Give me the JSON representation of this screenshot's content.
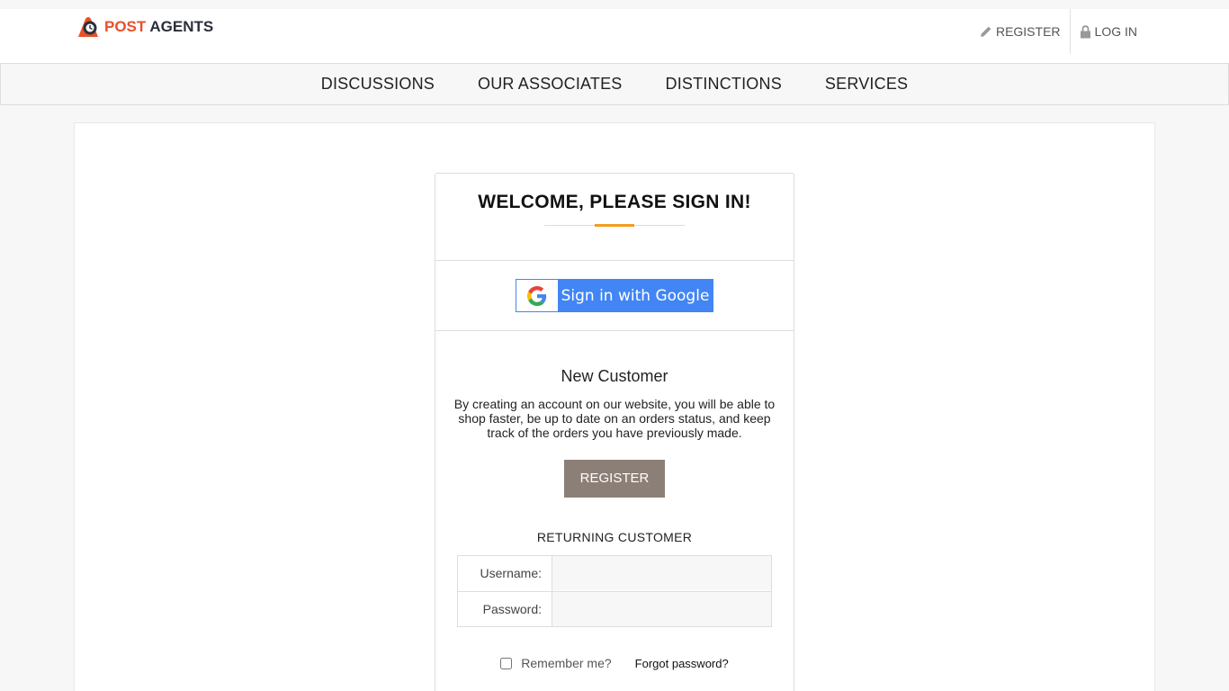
{
  "header": {
    "logo_part1": "POST",
    "logo_part2": "AGENTS",
    "register_label": "REGISTER",
    "login_label": "LOG IN"
  },
  "nav": {
    "items": [
      "DISCUSSIONS",
      "OUR ASSOCIATES",
      "DISTINCTIONS",
      "SERVICES"
    ]
  },
  "login_card": {
    "title": "WELCOME, PLEASE SIGN IN!",
    "google_label": "Sign in with Google",
    "new_customer_heading": "New Customer",
    "new_customer_text": "By creating an account on our website, you will be able to shop faster, be up to date on an orders status, and keep track of the orders you have previously made.",
    "register_button": "REGISTER",
    "returning_heading": "RETURNING CUSTOMER",
    "username_label": "Username:",
    "username_value": "",
    "password_label": "Password:",
    "password_value": "",
    "remember_label": "Remember me?",
    "remember_checked": false,
    "forgot_label": "Forgot password?"
  },
  "colors": {
    "brand_orange": "#e8502a",
    "accent_rule": "#f39c1f",
    "google_blue": "#4285f4",
    "register_button_bg": "#8c7f77"
  },
  "icons": {
    "register": "pencil-icon",
    "login": "lock-icon",
    "google": "google-g-icon",
    "logo": "post-agents-logo-icon"
  }
}
